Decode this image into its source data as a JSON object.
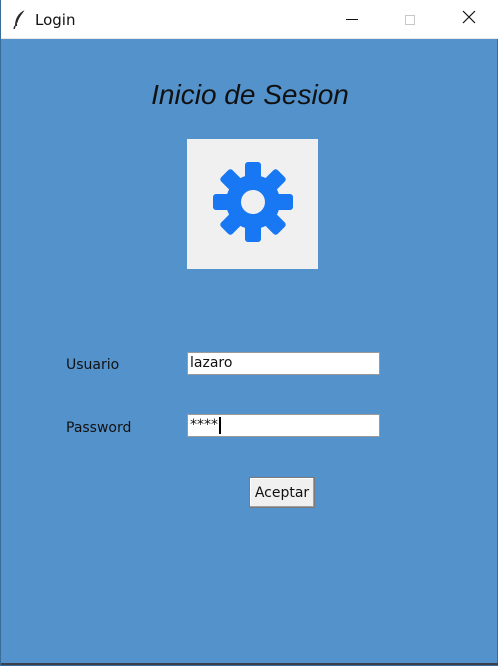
{
  "window": {
    "title": "Login",
    "app_icon": "feather-icon",
    "controls": [
      "minimize-icon",
      "maximize-icon",
      "close-icon"
    ],
    "background_color": "#5392cb"
  },
  "form": {
    "heading": "Inicio de Sesion",
    "logo_icon": "gear-icon",
    "logo_color": "#1877f2",
    "username_label": "Usuario",
    "username_value": "lazaro",
    "password_label": "Password",
    "password_value": "****",
    "submit_label": "Aceptar"
  }
}
